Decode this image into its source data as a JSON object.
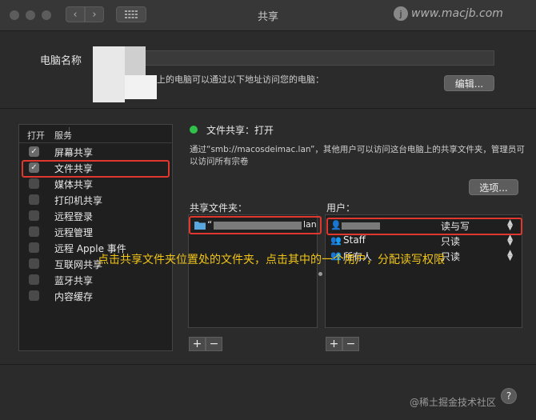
{
  "window": {
    "title": "共享",
    "nav_back": "‹",
    "nav_forward": "›"
  },
  "watermark_top": {
    "text": "www.macjb.com",
    "logo": "j"
  },
  "computer_name": {
    "label": "电脑名称",
    "address_text": "上的电脑可以通过以下地址访问您的电脑：",
    "edit_button": "编辑..."
  },
  "services": {
    "header_on": "打开",
    "header_service": "服务",
    "items": [
      {
        "label": "屏幕共享",
        "checked": true
      },
      {
        "label": "文件共享",
        "checked": true
      },
      {
        "label": "媒体共享",
        "checked": false
      },
      {
        "label": "打印机共享",
        "checked": false
      },
      {
        "label": "远程登录",
        "checked": false
      },
      {
        "label": "远程管理",
        "checked": false
      },
      {
        "label": "远程 Apple 事件",
        "checked": false
      },
      {
        "label": "互联网共享",
        "checked": false
      },
      {
        "label": "蓝牙共享",
        "checked": false
      },
      {
        "label": "内容缓存",
        "checked": false
      }
    ]
  },
  "status": {
    "text": "文件共享：打开",
    "color": "#2fc14a",
    "description": "通过“smb://macosdeimac.lan”，其他用户可以访问这台电脑上的共享文件夹，管理员可以访问所有宗卷",
    "options_button": "选项..."
  },
  "shared_folders": {
    "label": "共享文件夹：",
    "item_prefix": "“",
    "item_suffix": "lan"
  },
  "users": {
    "label": "用户：",
    "rows": [
      {
        "name": "",
        "permission": "读与写"
      },
      {
        "name": "Staff",
        "permission": "只读"
      },
      {
        "name": "所有人",
        "permission": "只读"
      }
    ]
  },
  "buttons": {
    "add": "+",
    "remove": "−"
  },
  "overlay_annotation": "点击共享文件夹位置处的文件夹，点击其中的一个用户，分配读写权限",
  "watermark_bottom": "@稀土掘金技术社区",
  "help": "?"
}
